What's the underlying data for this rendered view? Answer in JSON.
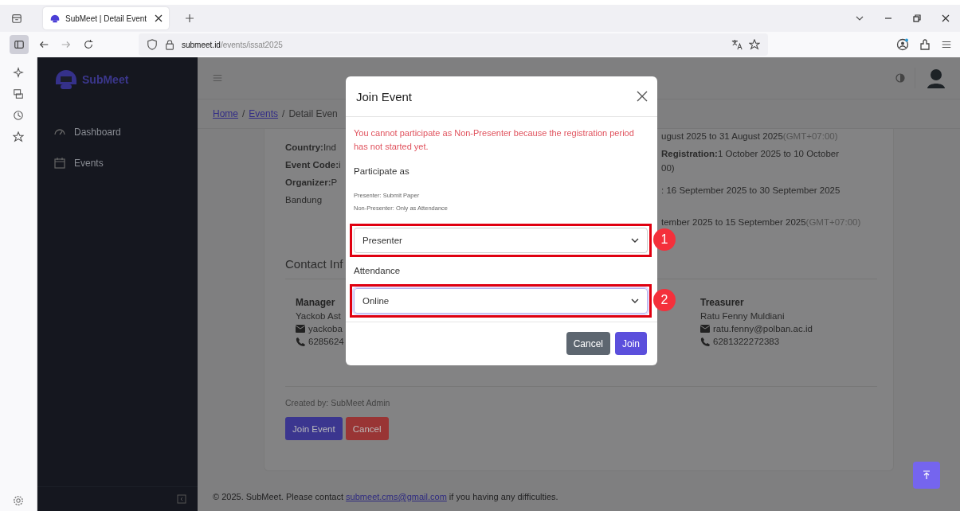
{
  "browser": {
    "tab_title": "SubMeet | Detail Event",
    "url_host": "submeet.id",
    "url_path": "/events/issat2025"
  },
  "sidebar": {
    "logo": "SubMeet",
    "items": [
      {
        "label": "Dashboard",
        "kind": "dashboard",
        "selected": false
      },
      {
        "label": "Events",
        "kind": "calendar",
        "selected": false
      }
    ]
  },
  "breadcrumb": [
    {
      "label": "Home",
      "kind": "link"
    },
    {
      "separator": "/",
      "label": "Events",
      "kind": "link"
    },
    {
      "separator": "/",
      "label": "Detail Even",
      "kind": "current"
    }
  ],
  "details_left": [
    {
      "label": "Country:",
      "value": "Ind"
    },
    {
      "label": "Event Code:",
      "value": "i"
    },
    {
      "label": "Organizer:",
      "value": "P"
    },
    {
      "value": "Bandung"
    }
  ],
  "details_right": [
    {
      "value": "ugust 2025 to 31 August 2025",
      "note": "(GMT+07:00)"
    },
    {
      "label": "Registration:",
      "value": "1 October 2025 to 10 October"
    },
    {
      "value": "00)"
    },
    {
      "value": ": 16 September 2025 to 30 September 2025"
    },
    {
      "value": "tember 2025 to 15 September 2025",
      "note": "(GMT+07:00)"
    }
  ],
  "contact": {
    "heading": "Contact Inf",
    "people": [
      {
        "role": "Manager",
        "name": "Yackob Ast",
        "email": "yackoba",
        "phone": "6285624"
      },
      {
        "role": "Treasurer",
        "name": "Ratu Fenny Muldiani",
        "email": "ratu.fenny@polban.ac.id",
        "phone": "6281322272383"
      }
    ]
  },
  "created_by": "Created by: SubMeet Admin",
  "actions": [
    {
      "label": "Join Event",
      "kind": "primary"
    },
    {
      "label": "Cancel",
      "kind": "danger"
    }
  ],
  "footer": {
    "before": "© 2025. SubMeet. Please contact",
    "link": "submeet.cms@gmail.com",
    "after": "if you having any difficulties."
  },
  "modal": {
    "title": "Join Event",
    "error": "You cannot participate as Non-Presenter because the registration period has not started yet.",
    "fields": [
      {
        "label": "Participate as",
        "help": [
          "Presenter: Submit Paper",
          "Non-Presenter: Only as Attendance"
        ],
        "value": "Presenter",
        "focused": false,
        "annotation": "1"
      },
      {
        "label": "Attendance",
        "value": "Online",
        "focused": true,
        "annotation": "2"
      }
    ],
    "buttons": [
      {
        "label": "Cancel",
        "kind": "secondary"
      },
      {
        "label": "Join",
        "kind": "primary"
      }
    ]
  }
}
